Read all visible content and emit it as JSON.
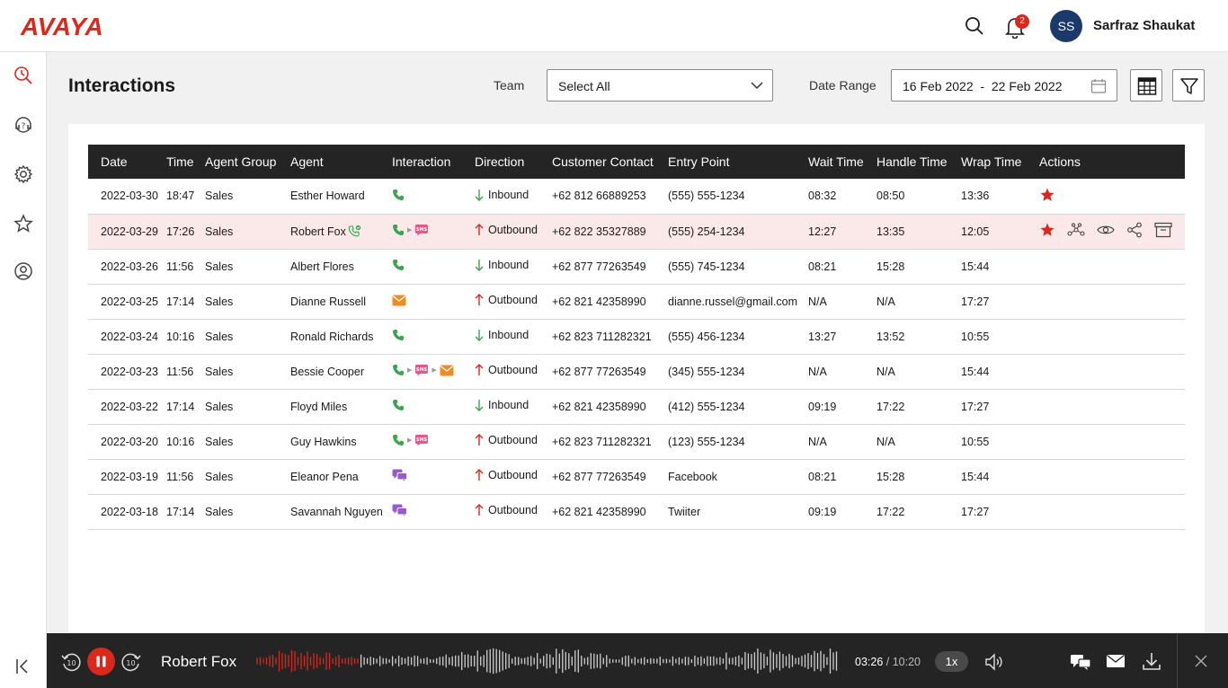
{
  "brand": {
    "logo_text": "AVAYA",
    "accent": "#da291c"
  },
  "topbar": {
    "search_icon": "search-icon",
    "bell_icon": "bell-icon",
    "notification_count": "2",
    "avatar_initials": "SS",
    "user_name": "Sarfraz Shaukat"
  },
  "sidenav": {
    "items": [
      {
        "icon": "history-search-icon",
        "active": true
      },
      {
        "icon": "support-agent-icon",
        "active": false
      },
      {
        "icon": "settings-gear-icon",
        "active": false
      },
      {
        "icon": "star-icon",
        "active": false
      },
      {
        "icon": "user-profile-icon",
        "active": false
      }
    ],
    "collapse_icon": "collapse-sidebar-icon"
  },
  "page": {
    "title": "Interactions",
    "team_label": "Team",
    "team_value": "Select All",
    "date_range_label": "Date Range",
    "date_from": "16 Feb 2022",
    "date_to": "22 Feb 2022"
  },
  "table": {
    "columns": [
      "Date",
      "Time",
      "Agent Group",
      "Agent",
      "Interaction",
      "Direction",
      "Customer Contact",
      "Entry Point",
      "Wait Time",
      "Handle Time",
      "Wrap Time",
      "Actions"
    ],
    "rows": [
      {
        "date": "2022-03-30",
        "time": "18:47",
        "group": "Sales",
        "agent": "Esther Howard",
        "channels": [
          "phone"
        ],
        "direction": "Inbound",
        "customer": "+62 812 66889253",
        "entry": "(555) 555-1234",
        "wait": "08:32",
        "handle": "08:50",
        "wrap": "13:36",
        "starred": true
      },
      {
        "date": "2022-03-29",
        "time": "17:26",
        "group": "Sales",
        "agent": "Robert Fox",
        "agent_live": true,
        "channels": [
          "phone",
          "sms"
        ],
        "direction": "Outbound",
        "customer": "+62 822 35327889",
        "entry": "(555) 254-1234",
        "wait": "12:27",
        "handle": "13:35",
        "wrap": "12:05",
        "starred": true,
        "selected": true
      },
      {
        "date": "2022-03-26",
        "time": "11:56",
        "group": "Sales",
        "agent": "Albert Flores",
        "channels": [
          "phone"
        ],
        "direction": "Inbound",
        "customer": "+62 877 77263549",
        "entry": "(555) 745-1234",
        "wait": "08:21",
        "handle": "15:28",
        "wrap": "15:44"
      },
      {
        "date": "2022-03-25",
        "time": "17:14",
        "group": "Sales",
        "agent": "Dianne Russell",
        "channels": [
          "email"
        ],
        "direction": "Outbound",
        "customer": "+62 821 42358990",
        "entry": "dianne.russel@gmail.com",
        "wait": "N/A",
        "handle": "N/A",
        "wrap": "17:27"
      },
      {
        "date": "2022-03-24",
        "time": "10:16",
        "group": "Sales",
        "agent": "Ronald Richards",
        "channels": [
          "phone"
        ],
        "direction": "Inbound",
        "customer": "+62 823 711282321",
        "entry": "(555) 456-1234",
        "wait": "13:27",
        "handle": "13:52",
        "wrap": "10:55"
      },
      {
        "date": "2022-03-23",
        "time": "11:56",
        "group": "Sales",
        "agent": "Bessie Cooper",
        "channels": [
          "phone",
          "sms",
          "email"
        ],
        "direction": "Outbound",
        "customer": "+62 877 77263549",
        "entry": "(345) 555-1234",
        "wait": "N/A",
        "handle": "N/A",
        "wrap": "15:44"
      },
      {
        "date": "2022-03-22",
        "time": "17:14",
        "group": "Sales",
        "agent": "Floyd Miles",
        "channels": [
          "phone"
        ],
        "direction": "Inbound",
        "customer": "+62 821 42358990",
        "entry": "(412) 555-1234",
        "wait": "09:19",
        "handle": "17:22",
        "wrap": "17:27"
      },
      {
        "date": "2022-03-20",
        "time": "10:16",
        "group": "Sales",
        "agent": "Guy Hawkins",
        "channels": [
          "phone",
          "sms"
        ],
        "direction": "Outbound",
        "customer": "+62 823 711282321",
        "entry": "(123) 555-1234",
        "wait": "N/A",
        "handle": "N/A",
        "wrap": "10:55"
      },
      {
        "date": "2022-03-19",
        "time": "11:56",
        "group": "Sales",
        "agent": "Eleanor Pena",
        "channels": [
          "chat"
        ],
        "direction": "Outbound",
        "customer": "+62 877 77263549",
        "entry": "Facebook",
        "wait": "08:21",
        "handle": "15:28",
        "wrap": "15:44"
      },
      {
        "date": "2022-03-18",
        "time": "17:14",
        "group": "Sales",
        "agent": "Savannah Nguyen",
        "channels": [
          "chat"
        ],
        "direction": "Outbound",
        "customer": "+62 821 42358990",
        "entry": "Twiiter",
        "wait": "09:19",
        "handle": "17:22",
        "wrap": "17:27"
      }
    ],
    "row_action_icons": [
      "star-icon",
      "journey-icon",
      "view-icon",
      "share-icon",
      "archive-icon"
    ],
    "colors": {
      "phone": "#3aa54a",
      "sms": "#e8578c",
      "email": "#f08c1e",
      "chat": "#9b59d0",
      "inbound": "#3aa54a",
      "outbound": "#da291c",
      "star": "#da291c"
    }
  },
  "player": {
    "agent_name": "Robert Fox",
    "current_time": "03:26",
    "total_time": "10:20",
    "progress": 0.18,
    "speed": "1x",
    "icons": [
      "rewind-10-icon",
      "pause-icon",
      "forward-10-icon",
      "volume-icon",
      "chat-transcript-icon",
      "email-icon",
      "download-icon",
      "close-icon"
    ]
  }
}
